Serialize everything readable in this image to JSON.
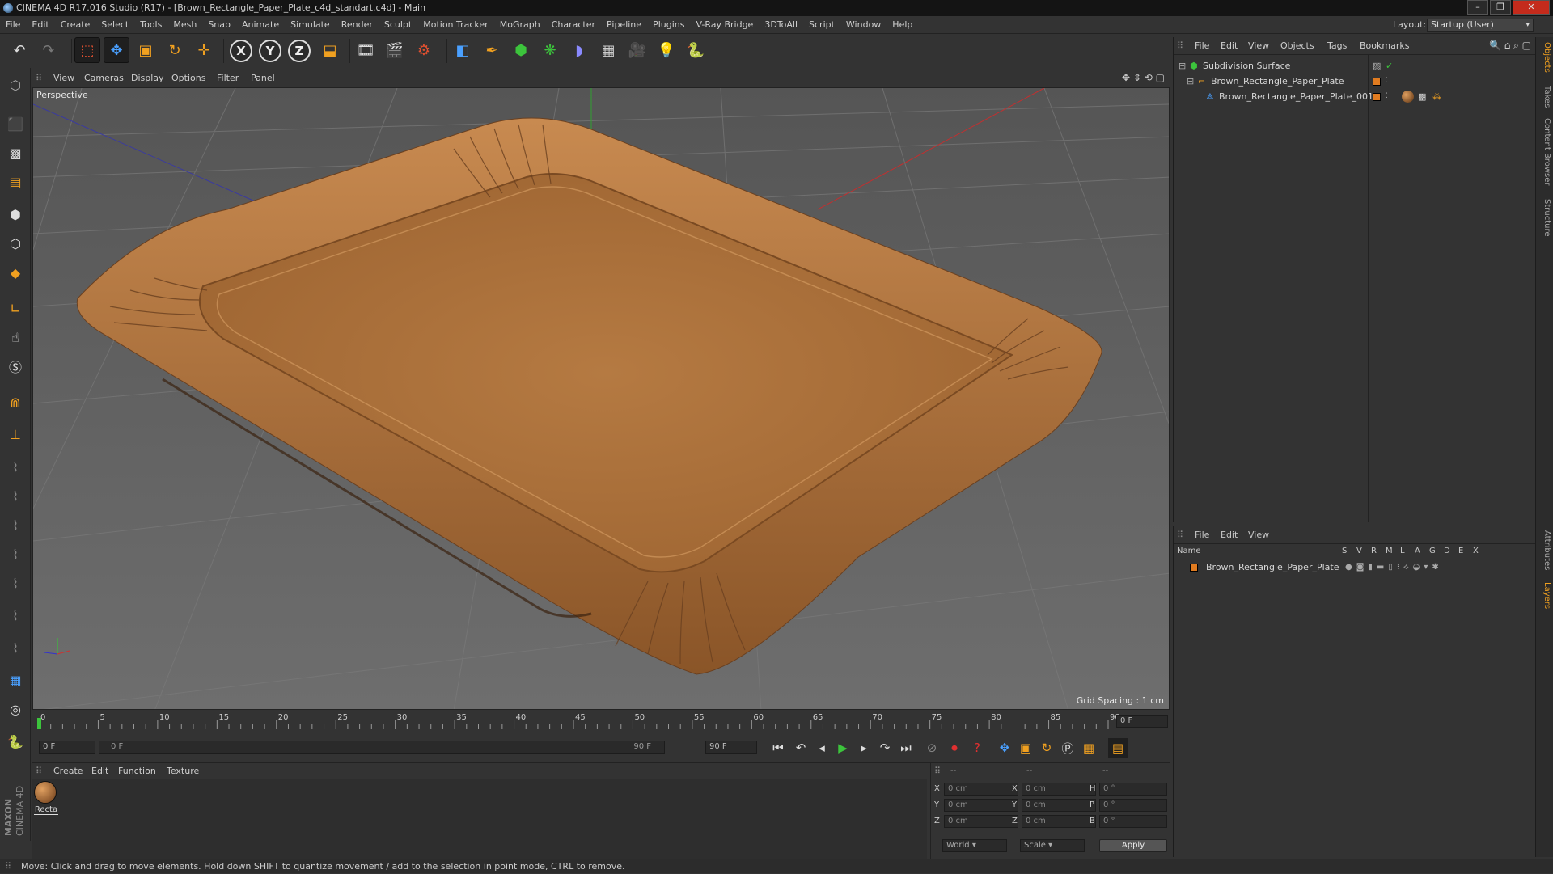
{
  "window": {
    "title": "CINEMA 4D R17.016 Studio (R17) - [Brown_Rectangle_Paper_Plate_c4d_standart.c4d] - Main"
  },
  "menubar": {
    "items": [
      "File",
      "Edit",
      "Create",
      "Select",
      "Tools",
      "Mesh",
      "Snap",
      "Animate",
      "Simulate",
      "Render",
      "Sculpt",
      "Motion Tracker",
      "MoGraph",
      "Character",
      "Pipeline",
      "Plugins",
      "V-Ray Bridge",
      "3DToAll",
      "Script",
      "Window",
      "Help"
    ],
    "layout_label": "Layout:",
    "layout_value": "Startup (User)"
  },
  "toolbar": {
    "axis_x": "X",
    "axis_y": "Y",
    "axis_z": "Z"
  },
  "viewport": {
    "menu": [
      "View",
      "Cameras",
      "Display",
      "Options",
      "Filter",
      "Panel"
    ],
    "label": "Perspective",
    "grid_spacing": "Grid Spacing : 1 cm"
  },
  "timeline": {
    "ticks": [
      "0",
      "5",
      "10",
      "15",
      "20",
      "25",
      "30",
      "35",
      "40",
      "45",
      "50",
      "55",
      "60",
      "65",
      "70",
      "75",
      "80",
      "85",
      "90"
    ],
    "current_frame": "0 F",
    "start_field": "0 F",
    "range_start": "0 F",
    "range_end": "90 F",
    "end_field": "90 F"
  },
  "material_manager": {
    "menu": [
      "Create",
      "Edit",
      "Function",
      "Texture"
    ],
    "materials": [
      {
        "label": "Recta"
      }
    ]
  },
  "coordinates": {
    "header": [
      "--",
      "--",
      "--"
    ],
    "rows": [
      {
        "a": "X",
        "av": "0 cm",
        "b": "X",
        "bv": "0 cm",
        "c": "H",
        "cv": "0 °"
      },
      {
        "a": "Y",
        "av": "0 cm",
        "b": "Y",
        "bv": "0 cm",
        "c": "P",
        "cv": "0 °"
      },
      {
        "a": "Z",
        "av": "0 cm",
        "b": "Z",
        "bv": "0 cm",
        "c": "B",
        "cv": "0 °"
      }
    ],
    "space": "World",
    "mode": "Scale",
    "apply": "Apply"
  },
  "object_manager": {
    "menu": [
      "File",
      "Edit",
      "View",
      "Objects",
      "Tags",
      "Bookmarks"
    ],
    "objects": [
      {
        "name": "Subdivision Surface"
      },
      {
        "name": "Brown_Rectangle_Paper_Plate"
      },
      {
        "name": "Brown_Rectangle_Paper_Plate_001"
      }
    ]
  },
  "layer_manager": {
    "menu": [
      "File",
      "Edit",
      "View"
    ],
    "col_name": "Name",
    "cols": [
      "S",
      "V",
      "R",
      "M",
      "L",
      "A",
      "G",
      "D",
      "E",
      "X"
    ],
    "layers": [
      {
        "name": "Brown_Rectangle_Paper_Plate"
      }
    ]
  },
  "right_tabs": [
    "Objects",
    "Takes",
    "Content Browser",
    "Structure",
    "Attributes",
    "Layers"
  ],
  "status": "Move: Click and drag to move elements. Hold down SHIFT to quantize movement / add to the selection in point mode, CTRL to remove.",
  "colors": {
    "plate": "#b4783f",
    "accent": "#e07b20",
    "play": "#3cc43c"
  }
}
